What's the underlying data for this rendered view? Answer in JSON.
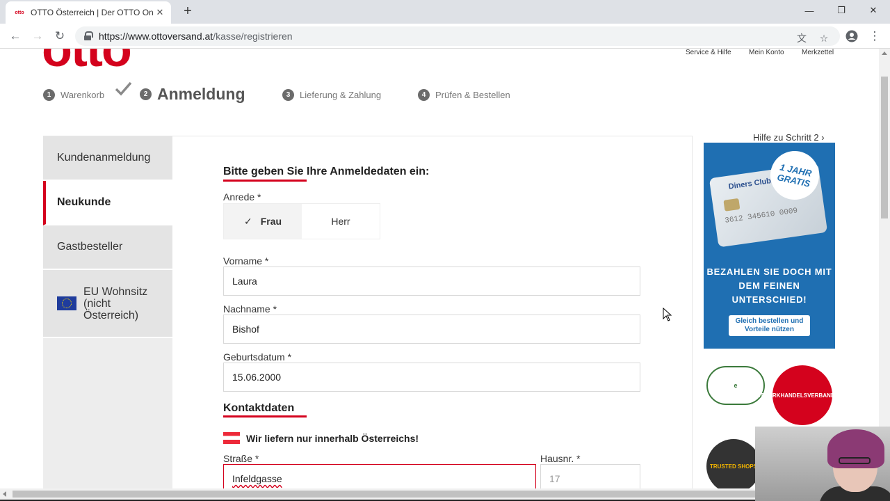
{
  "browser": {
    "tab_favicon": "otto",
    "tab_title": "OTTO Österreich | Der OTTO Onli",
    "url_host": "https://www.ottoversand.at",
    "url_path": "/kasse/registrieren"
  },
  "header": {
    "logo": "otto",
    "links": [
      "Service & Hilfe",
      "Mein Konto",
      "Merkzettel"
    ]
  },
  "stepper": {
    "steps": [
      {
        "num": "1",
        "label": "Warenkorb"
      },
      {
        "num": "2",
        "label": "Anmeldung"
      },
      {
        "num": "3",
        "label": "Lieferung & Zahlung"
      },
      {
        "num": "4",
        "label": "Prüfen & Bestellen"
      }
    ],
    "active_index": 1
  },
  "sidebar": {
    "items": [
      {
        "label": "Kundenanmeldung"
      },
      {
        "label": "Neukunde"
      },
      {
        "label": "Gastbesteller"
      },
      {
        "label": "EU Wohnsitz (nicht Österreich)"
      }
    ],
    "active_index": 1
  },
  "form": {
    "title": "Bitte geben Sie Ihre Anmeldedaten ein:",
    "salutation": {
      "label": "Anrede *",
      "options": [
        "Frau",
        "Herr"
      ],
      "selected": "Frau"
    },
    "firstname": {
      "label": "Vorname *",
      "value": "Laura"
    },
    "lastname": {
      "label": "Nachname *",
      "value": "Bishof"
    },
    "birthdate": {
      "label": "Geburtsdatum *",
      "value": "15.06.2000"
    },
    "contact_title": "Kontaktdaten",
    "delivery_note": "Wir liefern nur innerhalb Österreichs!",
    "street": {
      "label": "Straße *",
      "value": "Infeldgasse"
    },
    "housenumber": {
      "label": "Hausnr. *",
      "placeholder": "17"
    }
  },
  "right": {
    "help_link": "Hilfe zu Schritt 2",
    "promo": {
      "badge": "1 JAHR GRATIS",
      "card_brand": "Diners Club",
      "card_number": "3612 345610 0009",
      "headline": "BEZAHLEN SIE DOCH MIT DEM FEINEN UNTERSCHIED!",
      "button": "Gleich bestellen und Vorteile nützen"
    },
    "seals": [
      "TRUSTMARK",
      "HANDELSVERBAND",
      "AUSTRIA",
      "TRUSTED SHOPS"
    ]
  },
  "colors": {
    "brand_red": "#d4021d",
    "promo_blue": "#1f6fb2"
  }
}
